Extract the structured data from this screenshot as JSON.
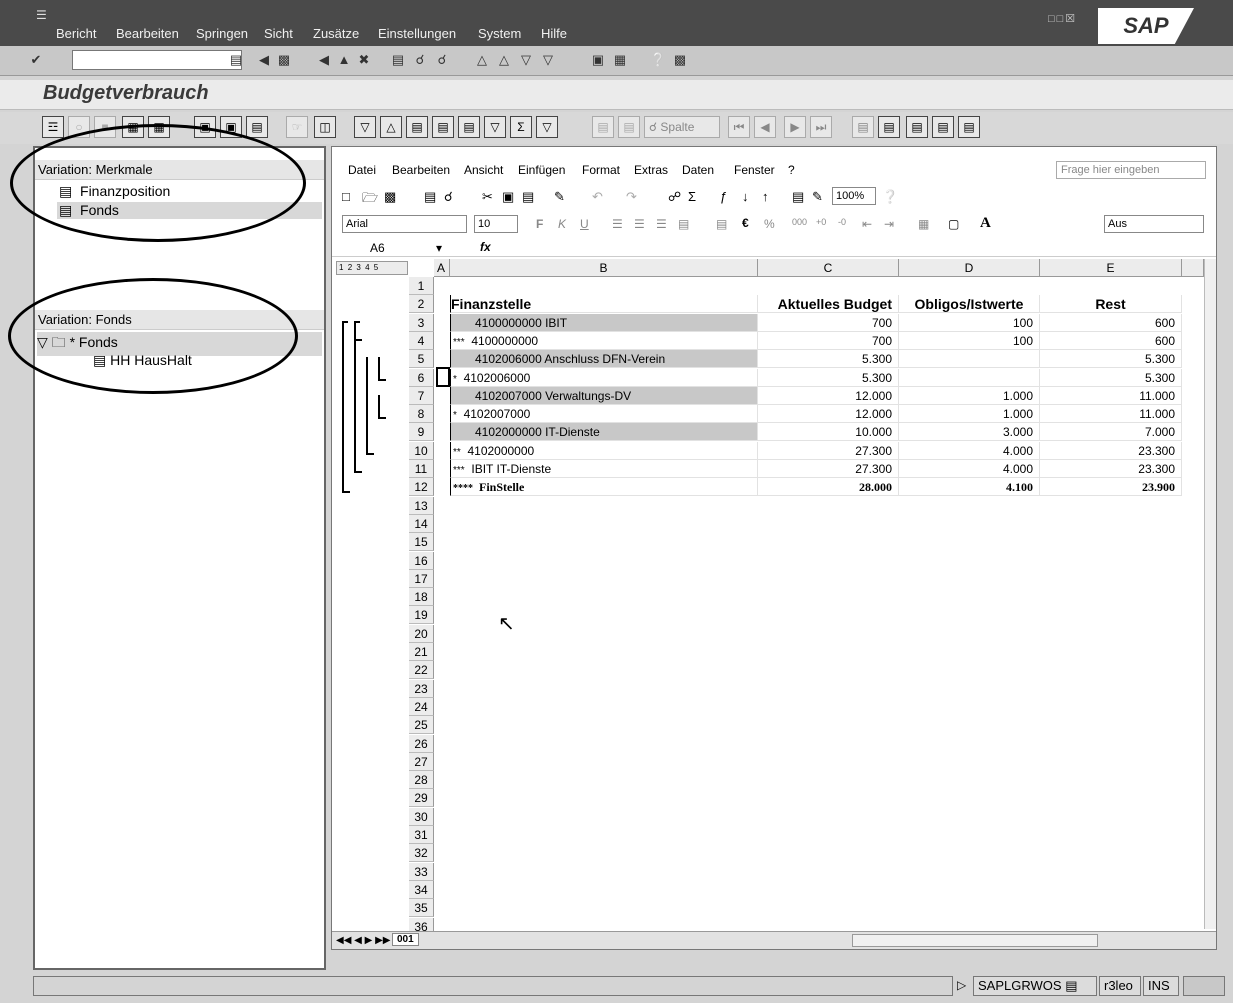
{
  "menubar": {
    "items": [
      "Bericht",
      "Bearbeiten",
      "Springen",
      "Sicht",
      "Zusätze",
      "Einstellungen",
      "System",
      "Hilfe"
    ],
    "logo": "SAP"
  },
  "title": "Budgetverbrauch",
  "apptoolbar": {
    "column_label": "Spalte"
  },
  "left_panel": {
    "merkmale_header": "Variation: Merkmale",
    "merkmale_items": [
      "Finanzposition",
      "Fonds"
    ],
    "fonds_header": "Variation: Fonds",
    "fonds_root": "* Fonds",
    "fonds_child": "HH HausHalt"
  },
  "excel": {
    "menu": [
      "Datei",
      "Bearbeiten",
      "Ansicht",
      "Einfügen",
      "Format",
      "Extras",
      "Daten",
      "Fenster",
      "?"
    ],
    "help_placeholder": "Frage hier eingeben",
    "zoom": "100%",
    "font_name": "Arial",
    "font_size": "10",
    "aus_box": "Aus",
    "name_box": "A6",
    "fx": "fx",
    "outline_levels": [
      "1",
      "2",
      "3",
      "4",
      "5"
    ],
    "columns": [
      "A",
      "B",
      "C",
      "D",
      "E"
    ],
    "header_row": {
      "b": "Finanzstelle",
      "c": "Aktuelles Budget",
      "d": "Obligos/Istwerte",
      "e": "Rest"
    },
    "rows": [
      {
        "prefix": "",
        "b": "4100000000  IBIT",
        "c": "700",
        "d": "100",
        "e": "600",
        "shade": true,
        "indent": true
      },
      {
        "prefix": "***",
        "b": "4100000000",
        "c": "700",
        "d": "100",
        "e": "600",
        "shade": false,
        "indent": false
      },
      {
        "prefix": "",
        "b": "4102006000  Anschluss DFN-Verein",
        "c": "5.300",
        "d": "",
        "e": "5.300",
        "shade": true,
        "indent": true
      },
      {
        "prefix": "*",
        "b": "4102006000",
        "c": "5.300",
        "d": "",
        "e": "5.300",
        "shade": false,
        "indent": false
      },
      {
        "prefix": "",
        "b": "4102007000  Verwaltungs-DV",
        "c": "12.000",
        "d": "1.000",
        "e": "11.000",
        "shade": true,
        "indent": true
      },
      {
        "prefix": "*",
        "b": "4102007000",
        "c": "12.000",
        "d": "1.000",
        "e": "11.000",
        "shade": false,
        "indent": false
      },
      {
        "prefix": "",
        "b": "4102000000  IT-Dienste",
        "c": "10.000",
        "d": "3.000",
        "e": "7.000",
        "shade": true,
        "indent": true
      },
      {
        "prefix": "**",
        "b": "4102000000",
        "c": "27.300",
        "d": "4.000",
        "e": "23.300",
        "shade": false,
        "indent": false
      },
      {
        "prefix": "***",
        "b": "IBIT IT-Dienste",
        "c": "27.300",
        "d": "4.000",
        "e": "23.300",
        "shade": false,
        "indent": false
      },
      {
        "prefix": "****",
        "b": "FinStelle",
        "c": "28.000",
        "d": "4.100",
        "e": "23.900",
        "shade": false,
        "indent": false,
        "bold": true
      }
    ],
    "sheet_tab": "001"
  },
  "statusbar": {
    "program": "SAPLGRWOS",
    "server": "r3leo",
    "mode": "INS"
  }
}
